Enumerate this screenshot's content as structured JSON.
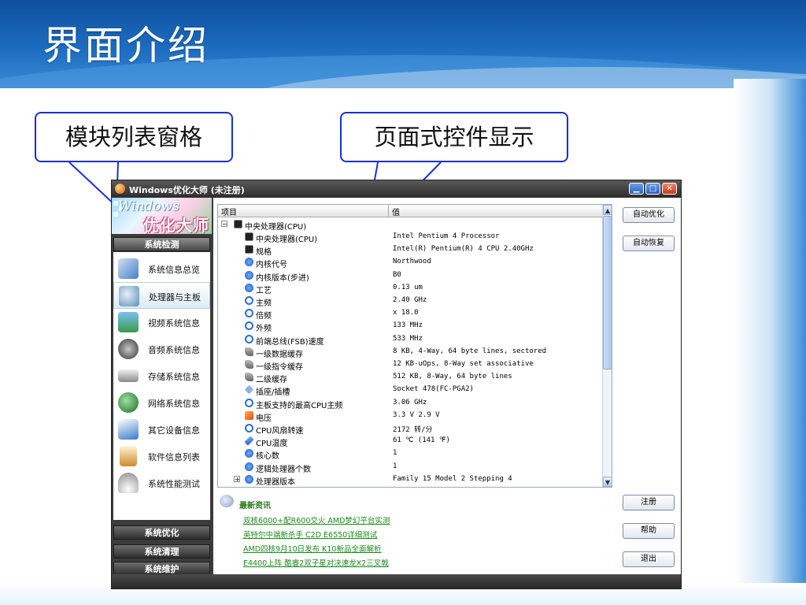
{
  "slide": {
    "title": "界面介绍",
    "callout_left": "模块列表窗格",
    "callout_right": "页面式控件显示"
  },
  "window": {
    "title": "Windows优化大师 (未注册)",
    "min_icon": "minimize-icon",
    "max_icon": "maximize-icon",
    "close_icon": "close-icon",
    "min_glyph": "▁",
    "max_glyph": "□",
    "close_glyph": "✕"
  },
  "logo": {
    "word": "Windows",
    "mark": "优化大师"
  },
  "sidebar": {
    "section_detect": "系统检测",
    "section_optimize": "系统优化",
    "section_clean": "系统清理",
    "section_maintain": "系统维护",
    "items": [
      {
        "label": "系统信息总览",
        "icon": "computer-icon",
        "color": "#4a7fc4"
      },
      {
        "label": "处理器与主板",
        "icon": "magnifier-chip-icon",
        "color": "#5a8fb8"
      },
      {
        "label": "视频系统信息",
        "icon": "monitor-icon",
        "color": "#3a9a4a"
      },
      {
        "label": "音频系统信息",
        "icon": "speaker-icon",
        "color": "#444444"
      },
      {
        "label": "存储系统信息",
        "icon": "disk-icon",
        "color": "#9a9a9a"
      },
      {
        "label": "网络系统信息",
        "icon": "globe-icon",
        "color": "#2a8a3a"
      },
      {
        "label": "其它设备信息",
        "icon": "scanner-icon",
        "color": "#3a7ac8"
      },
      {
        "label": "软件信息列表",
        "icon": "document-icon",
        "color": "#d08a2a"
      },
      {
        "label": "系统性能测试",
        "icon": "gauge-icon",
        "color": "#8a8a8a"
      }
    ]
  },
  "tree": {
    "col_item": "项目",
    "col_value": "值",
    "expand_minus": "−",
    "expand_plus": "+",
    "root": "中央处理器(CPU)",
    "rows": [
      {
        "name": "中央处理器(CPU)",
        "value": "Intel Pentium 4 Processor",
        "icon": "chip"
      },
      {
        "name": "规格",
        "value": "Intel(R) Pentium(R) 4 CPU 2.40GHz",
        "icon": "chip"
      },
      {
        "name": "内核代号",
        "value": "Northwood",
        "icon": "info"
      },
      {
        "name": "内核版本(步进)",
        "value": "B0",
        "icon": "info"
      },
      {
        "name": "工艺",
        "value": "0.13 um",
        "icon": "info"
      },
      {
        "name": "主频",
        "value": "2.40 GHz",
        "icon": "search"
      },
      {
        "name": "倍频",
        "value": "x 18.0",
        "icon": "search"
      },
      {
        "name": "外频",
        "value": "133 MHz",
        "icon": "search"
      },
      {
        "name": "前端总线(FSB)速度",
        "value": "533 MHz",
        "icon": "search"
      },
      {
        "name": "一级数据缓存",
        "value": "8 KB, 4-Way, 64 byte lines, sectored",
        "icon": "cache"
      },
      {
        "name": "一级指令缓存",
        "value": "12 KB-uOps, 8-Way set associative",
        "icon": "cache"
      },
      {
        "name": "二级缓存",
        "value": "512 KB, 8-Way, 64 byte lines",
        "icon": "cache"
      },
      {
        "name": "插座/插槽",
        "value": "Socket 478(FC-PGA2)",
        "icon": "socket"
      },
      {
        "name": "主板支持的最高CPU主频",
        "value": "3.06 GHz",
        "icon": "search"
      },
      {
        "name": "电压",
        "value": "3.3 V 2.9 V",
        "icon": "power"
      },
      {
        "name": "CPU风扇转速",
        "value": "2172 转/分",
        "icon": "search"
      },
      {
        "name": "CPU温度",
        "value": "61 ℃ (141 ℉)",
        "icon": "temp"
      },
      {
        "name": "核心数",
        "value": "1",
        "icon": "info"
      },
      {
        "name": "逻辑处理器个数",
        "value": "1",
        "icon": "info"
      },
      {
        "name": "处理器版本",
        "value": "Family 15 Model 2 Stepping 4",
        "icon": "info"
      }
    ]
  },
  "buttons": {
    "auto_optimize": "自动优化",
    "auto_restore": "自动恢复",
    "register": "注册",
    "help": "帮助",
    "exit": "退出"
  },
  "scroll": {
    "up_glyph": "▲",
    "down_glyph": "▼"
  },
  "news": {
    "title": "最新资讯",
    "links": [
      "双核6000+配R600交火 AMD梦幻平台实测",
      "英特尔中端新杀手 C2D E6550详细测试",
      "AMD四核9月10日发布 K10新品全面解析",
      "E4400上阵 酷睿2双子星对决速龙X2三叉戟"
    ]
  }
}
